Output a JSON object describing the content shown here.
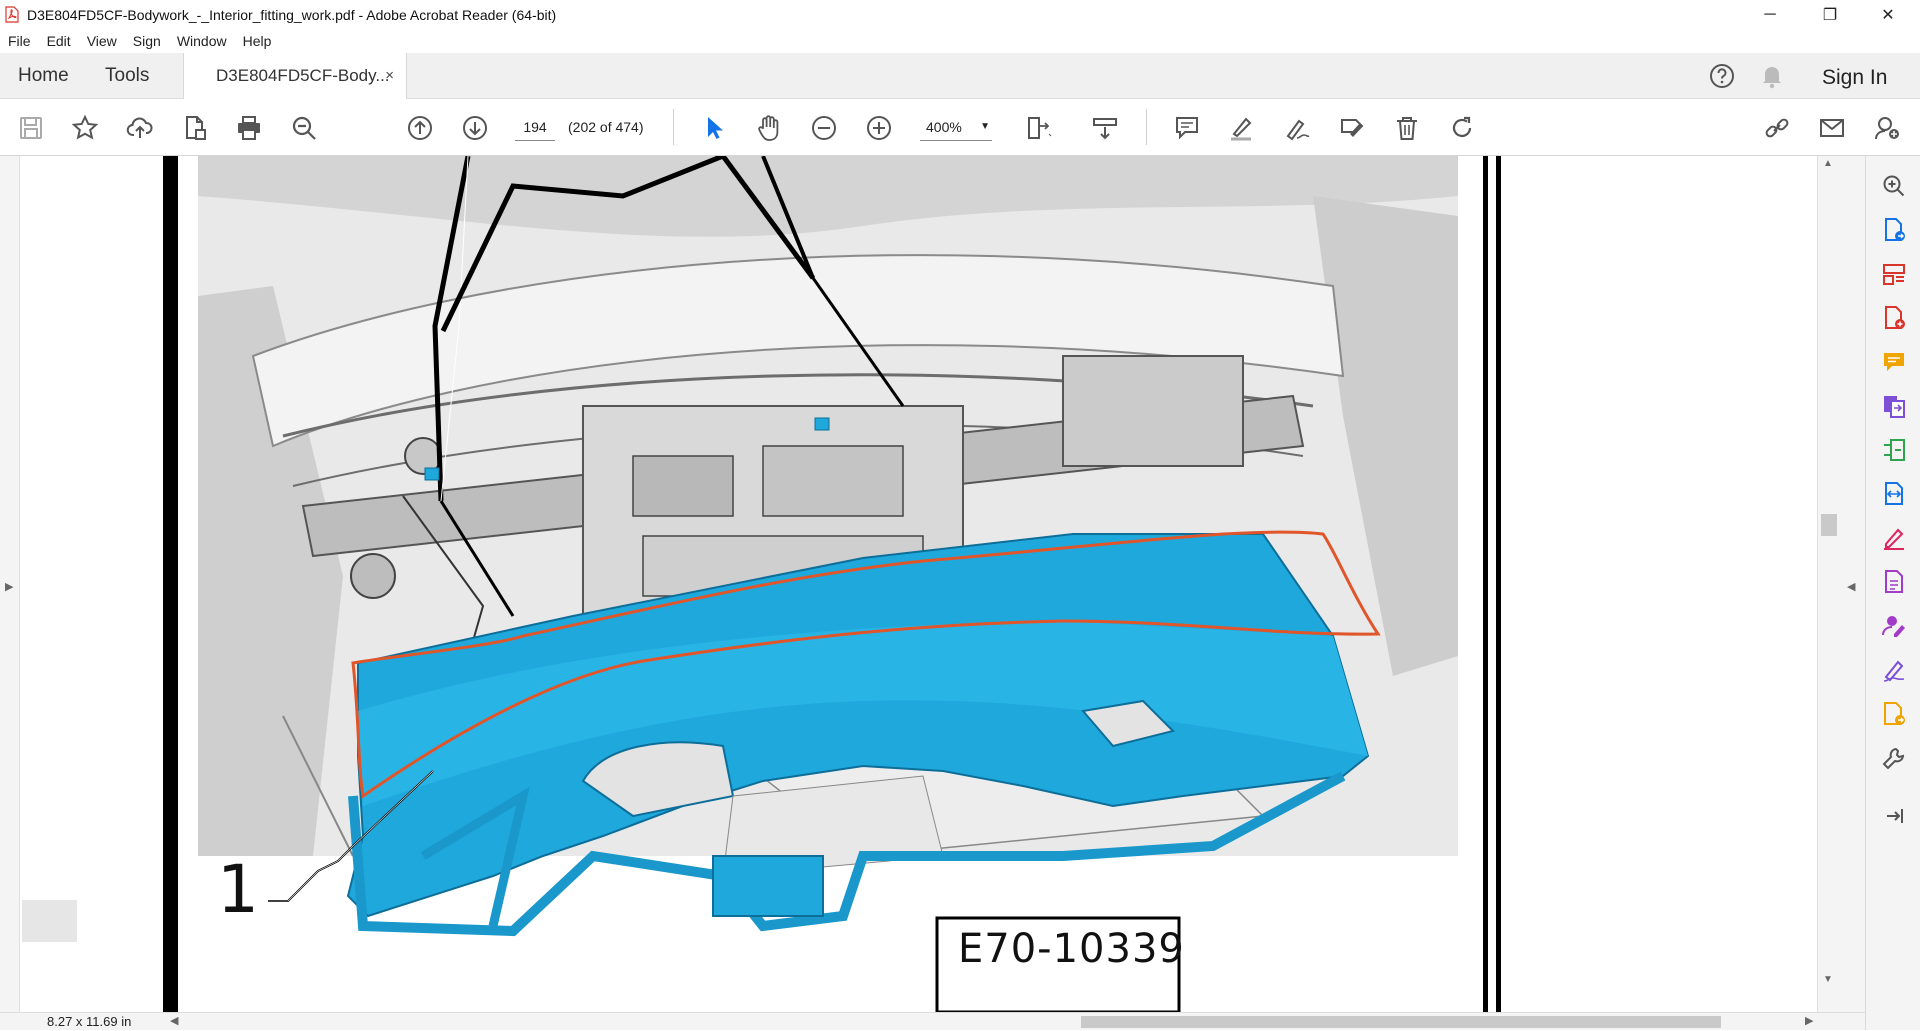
{
  "window": {
    "title": "D3E804FD5CF-Bodywork_-_Interior_fitting_work.pdf - Adobe Acrobat Reader (64-bit)",
    "minimize": "─",
    "maximize": "❐",
    "close": "✕"
  },
  "menu": [
    "File",
    "Edit",
    "View",
    "Sign",
    "Window",
    "Help"
  ],
  "tabs": {
    "home": "Home",
    "tools": "Tools",
    "document": "D3E804FD5CF-Body...",
    "close": "×",
    "sign_in": "Sign In"
  },
  "toolbar": {
    "current_page": "194",
    "page_count": "(202 of 474)",
    "zoom": "400%"
  },
  "figure": {
    "callout": "1",
    "reference": "E70-10339",
    "part_color": "#1fa8dc",
    "outline_color": "#e0552a"
  },
  "status": {
    "page_size": "8.27 x 11.69 in"
  },
  "colors": {
    "accent_blue": "#1473e6",
    "icon_gray": "#555555"
  }
}
